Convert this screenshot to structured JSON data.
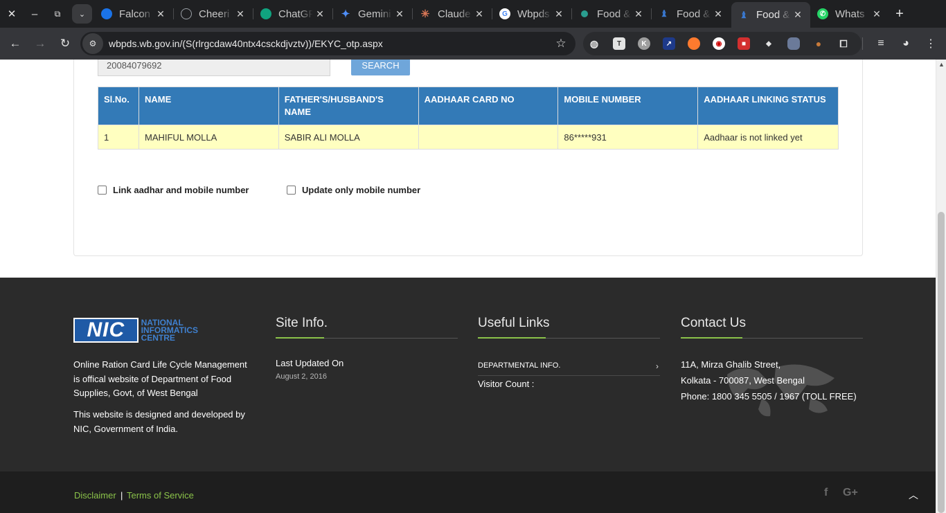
{
  "browser": {
    "tabs": [
      {
        "title": "Falcon",
        "icon": "falcon-icon",
        "color": "#1a73e8"
      },
      {
        "title": "Cheeri",
        "icon": "chat-bubble-icon",
        "color": "#9aa0a6"
      },
      {
        "title": "ChatGPT",
        "icon": "chatgpt-icon",
        "color": "#10a37f"
      },
      {
        "title": "Gemini",
        "icon": "gemini-icon",
        "color": "#4f8ef7"
      },
      {
        "title": "Claude",
        "icon": "claude-icon",
        "color": "#d97757"
      },
      {
        "title": "Wbpds",
        "icon": "google-icon",
        "color": "#4285f4"
      },
      {
        "title": "Food &",
        "icon": "food-icon",
        "color": "#2a9d8f"
      },
      {
        "title": "Food &",
        "icon": "wb-emblem-icon",
        "color": "#3a7bd5"
      },
      {
        "title": "Food &",
        "icon": "wb-emblem-icon",
        "color": "#3a7bd5"
      },
      {
        "title": "Whats",
        "icon": "whatsapp-icon",
        "color": "#25d366"
      }
    ],
    "url": "wbpds.wb.gov.in/(S(rlrgcdaw40ntx4csckdjvztv))/EKYC_otp.aspx"
  },
  "search": {
    "ration_card_value": "20084079692",
    "button_label": "SEARCH"
  },
  "table": {
    "headers": [
      "Sl.No.",
      "NAME",
      "FATHER'S/HUSBAND'S NAME",
      "AADHAAR CARD NO",
      "MOBILE NUMBER",
      "AADHAAR LINKING STATUS"
    ],
    "rows": [
      [
        "1",
        "MAHIFUL MOLLA",
        "SABIR ALI MOLLA",
        "",
        "86*****931",
        "Aadhaar is not linked yet"
      ]
    ],
    "header_color": "#337ab7",
    "row_color": "#ffffc0"
  },
  "options": {
    "link_aadhar_label": "Link aadhar and mobile number",
    "update_mobile_label": "Update only mobile number"
  },
  "footer": {
    "logo": {
      "mark": "NIC",
      "line1": "NATIONAL",
      "line2": "INFORMATICS",
      "line3": "CENTRE"
    },
    "desc1": "Online Ration Card Life Cycle Management is offical website of Department of Food Supplies, Govt, of West Bengal",
    "desc2": "This website is designed and developed by NIC, Government of India.",
    "site_info": {
      "heading": "Site Info.",
      "last_updated_label": "Last Updated On",
      "last_updated_date": "August 2, 2016"
    },
    "useful_links": {
      "heading": "Useful Links",
      "dept_link": "DEPARTMENTAL INFO.",
      "visitor_count": "Visitor Count :"
    },
    "contact": {
      "heading": "Contact Us",
      "line1": "11A, Mirza Ghalib Street,",
      "line2": "Kolkata - 700087, West Bengal",
      "line3": "Phone: 1800 345 5505 / 1967 (TOLL FREE)"
    },
    "accent": "#8bc34a"
  },
  "subfooter": {
    "disclaimer": "Disclaimer",
    "pipe": "|",
    "terms": "Terms of Service",
    "social": [
      "facebook-icon",
      "google-plus-icon"
    ]
  }
}
